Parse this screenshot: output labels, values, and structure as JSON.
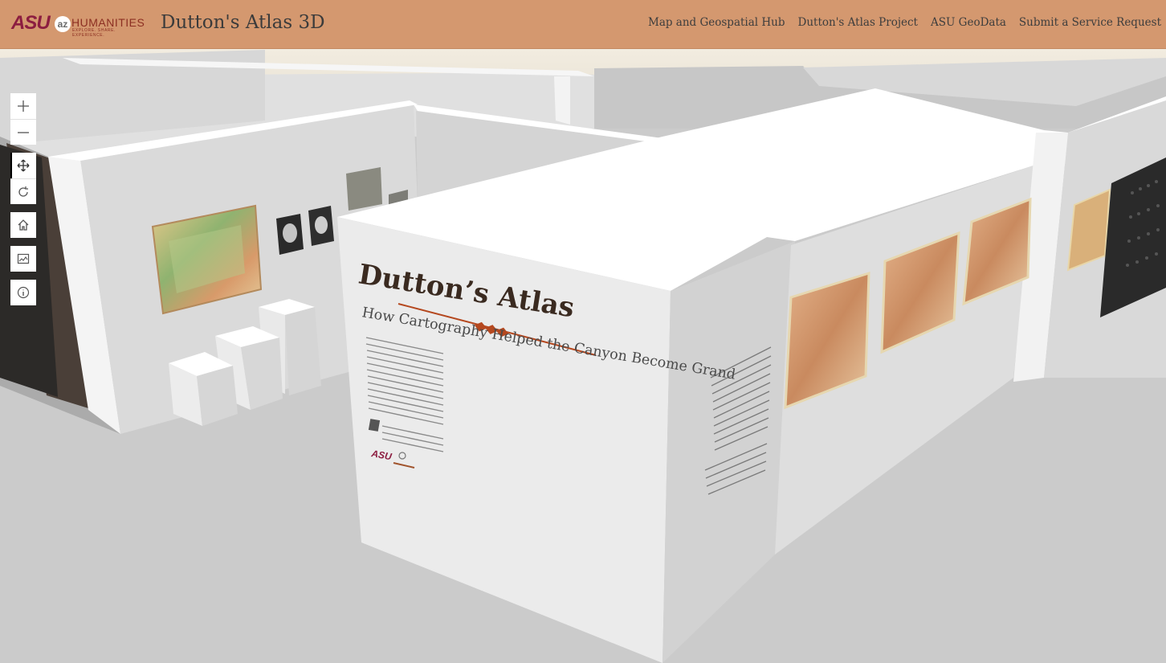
{
  "header": {
    "logo_asu": "ASU",
    "logo_az": "az",
    "logo_humanities": "HUMANITIES",
    "logo_tagline": "EXPLORE. SHARE. EXPERIENCE.",
    "title": "Dutton's Atlas 3D",
    "nav": [
      {
        "label": "Map and Geospatial Hub"
      },
      {
        "label": "Dutton's Atlas Project"
      },
      {
        "label": "ASU GeoData"
      },
      {
        "label": "Submit a Service Request"
      }
    ]
  },
  "toolbar": {
    "buttons": [
      {
        "icon": "zoom-in-icon"
      },
      {
        "icon": "zoom-out-icon"
      },
      {
        "icon": "pan-icon"
      },
      {
        "icon": "rotate-icon"
      },
      {
        "icon": "home-icon"
      },
      {
        "icon": "basemap-gallery-icon"
      },
      {
        "icon": "info-icon"
      }
    ]
  },
  "exhibit": {
    "title": "Dutton’s Atlas",
    "subtitle": "How Cartography Helped the Canyon Become Grand",
    "logo_asu": "ASU"
  },
  "colors": {
    "header_bg": "#d4986f",
    "asu_maroon": "#8c1d40",
    "accent_rust": "#b5481f"
  }
}
